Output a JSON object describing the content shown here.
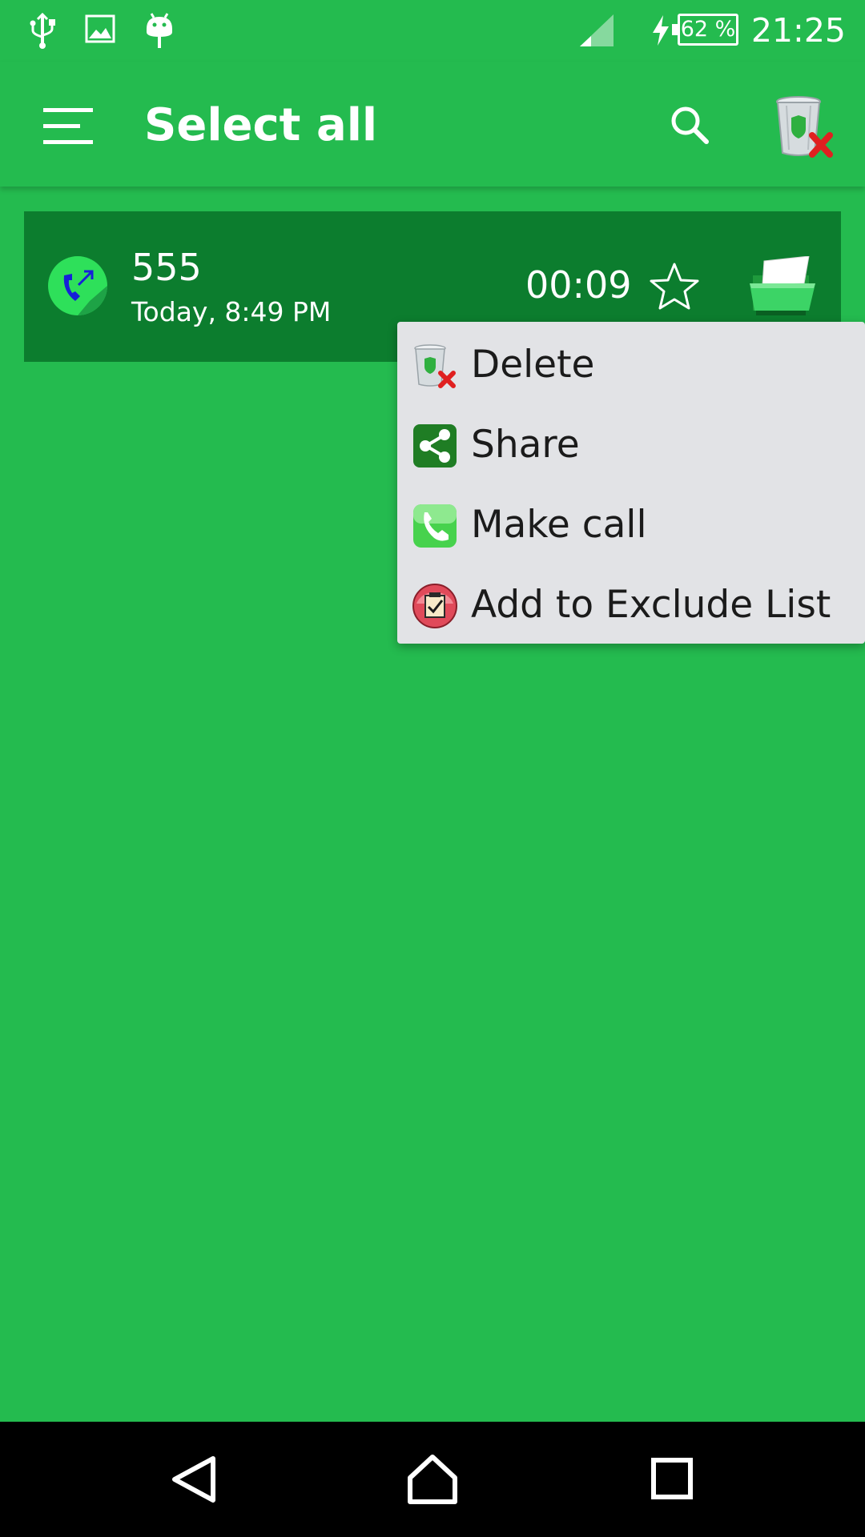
{
  "status_bar": {
    "time": "21:25",
    "battery": "62 %",
    "icons": [
      "usb-icon",
      "image-icon",
      "android-icon",
      "signal-icon",
      "charging-icon",
      "battery-icon"
    ]
  },
  "app_bar": {
    "title": "Select all",
    "icons": [
      "menu-icon",
      "search-icon",
      "recycle-bin-icon"
    ]
  },
  "call_log": {
    "items": [
      {
        "number": "555",
        "time": "Today, 8:49 PM",
        "duration": "00:09",
        "icons": [
          "outgoing-call-icon",
          "star-icon",
          "open-folder-icon"
        ]
      }
    ]
  },
  "context_menu": {
    "items": [
      {
        "label": "Delete",
        "icon": "recycle-bin-icon"
      },
      {
        "label": "Share",
        "icon": "share-icon"
      },
      {
        "label": "Make call",
        "icon": "phone-icon"
      },
      {
        "label": "Add to Exclude List",
        "icon": "exclude-list-icon"
      }
    ]
  },
  "nav_bar": {
    "icons": [
      "back-icon",
      "home-icon",
      "recents-icon"
    ]
  },
  "colors": {
    "background": "#24bb4f",
    "row_selected": "#0c7d2e",
    "menu_background": "#e2e3e6",
    "nav_bar": "#000000"
  }
}
